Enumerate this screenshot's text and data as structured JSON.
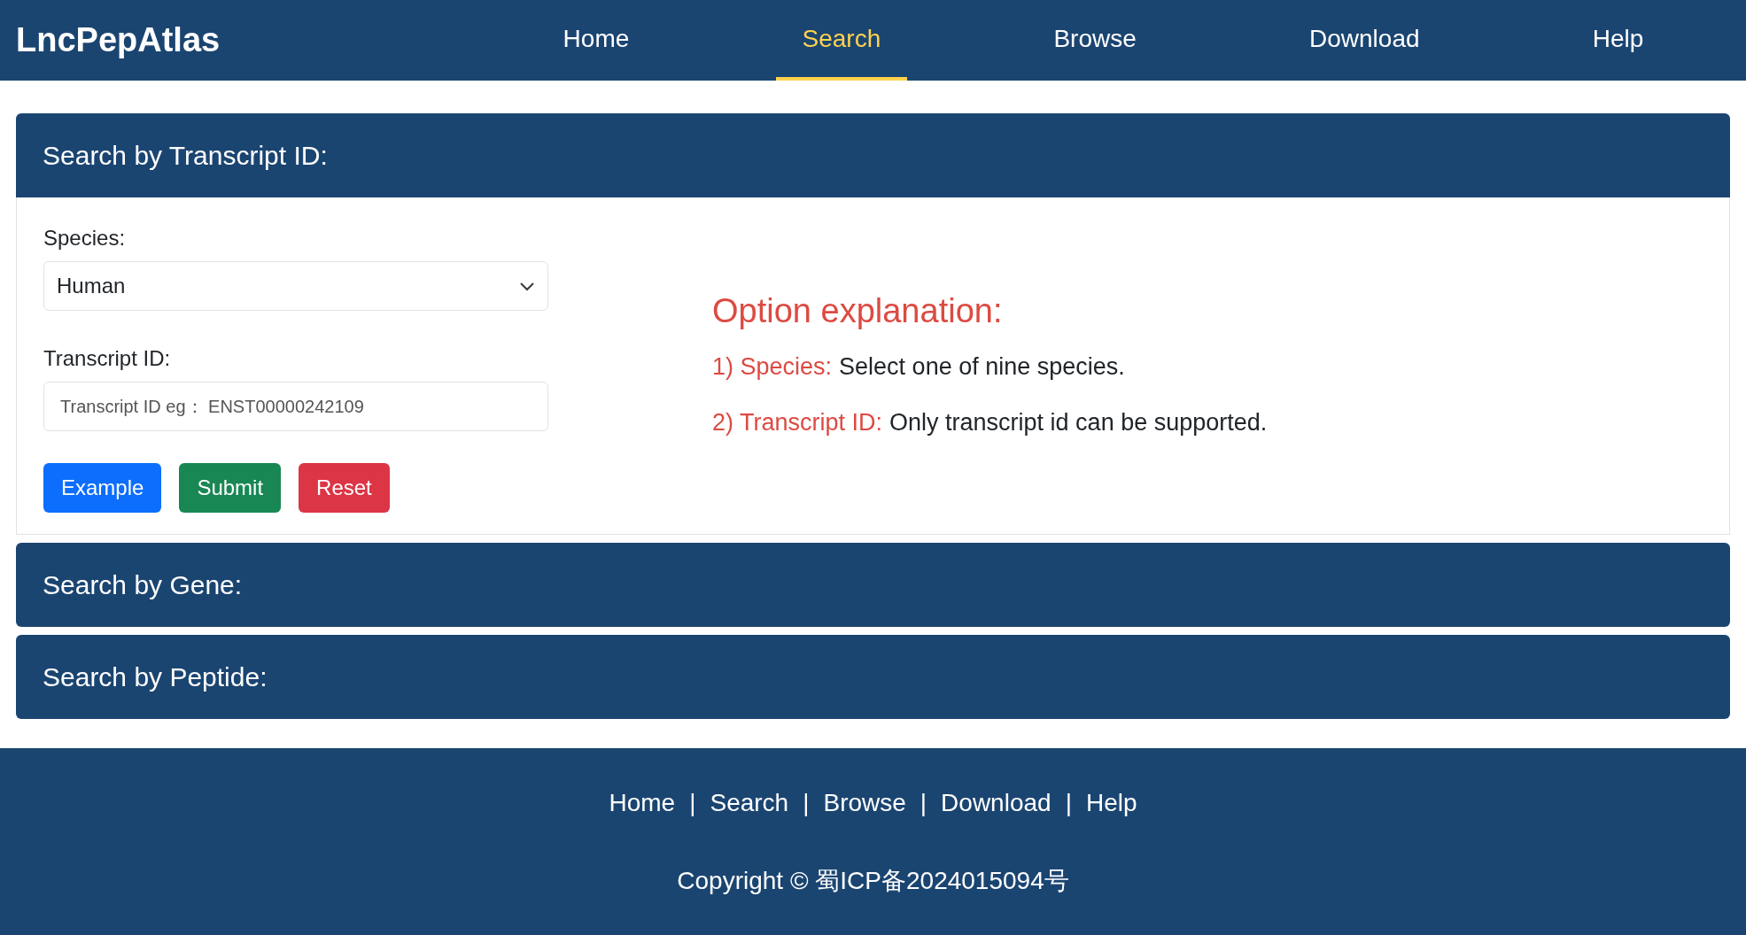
{
  "header": {
    "logo": "LncPepAtlas",
    "nav": [
      {
        "label": "Home",
        "selected": false
      },
      {
        "label": "Search",
        "selected": true
      },
      {
        "label": "Browse",
        "selected": false
      },
      {
        "label": "Download",
        "selected": false
      },
      {
        "label": "Help",
        "selected": false
      }
    ]
  },
  "sections": [
    {
      "title": "Search by Transcript ID:",
      "expanded": true,
      "form": {
        "species_label": "Species:",
        "species_value": "Human",
        "id_label": "Transcript ID:",
        "id_placeholder": "Transcript ID eg： ENST00000242109",
        "buttons": [
          {
            "label": "Example",
            "kind": "example"
          },
          {
            "label": "Submit",
            "kind": "submit"
          },
          {
            "label": "Reset",
            "kind": "reset"
          }
        ]
      },
      "explanation": {
        "title": "Option explanation:",
        "items": [
          {
            "label": "1) Species:",
            "text": "Select one of nine species."
          },
          {
            "label": "2) Transcript ID:",
            "text": "Only transcript id can be supported."
          }
        ]
      }
    },
    {
      "title": "Search by Gene:",
      "expanded": false
    },
    {
      "title": "Search by Peptide:",
      "expanded": false
    }
  ],
  "footer": {
    "links": [
      "Home",
      "Search",
      "Browse",
      "Download",
      "Help"
    ],
    "separators": [
      "|",
      "|",
      "|",
      "|"
    ],
    "copyright": "Copyright © 蜀ICP备2024015094号"
  }
}
